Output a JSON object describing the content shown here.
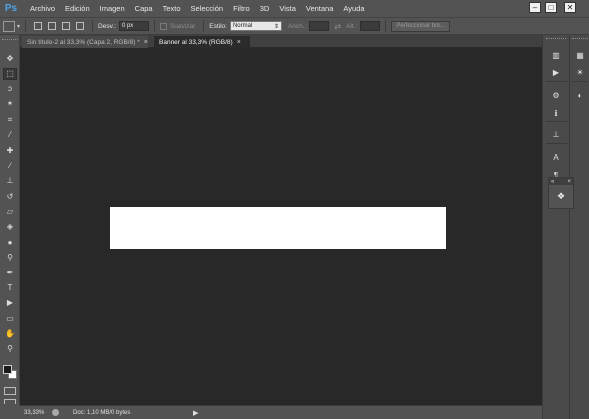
{
  "app": {
    "logo": "Ps"
  },
  "menu": [
    "Archivo",
    "Edición",
    "Imagen",
    "Capa",
    "Texto",
    "Selección",
    "Filtro",
    "3D",
    "Vista",
    "Ventana",
    "Ayuda"
  ],
  "window_controls": {
    "minimize": "–",
    "maximize": "□",
    "close": "✕"
  },
  "options_bar": {
    "feather_label": "Desv.:",
    "feather_value": "0 px",
    "antialias_label": "Suavizar",
    "style_label": "Estilo:",
    "style_value": "Normal",
    "width_label": "Anch.:",
    "height_label": "Alt.:",
    "refine_button": "Perfeccionar bor..."
  },
  "tabs": [
    {
      "label": "Sin título-2 al 33,3% (Capa 2, RGB/8) *",
      "active": false,
      "close": "×"
    },
    {
      "label": "Banner al 33,3% (RGB/8)",
      "active": true,
      "close": "×"
    }
  ],
  "tools": [
    {
      "name": "move-tool",
      "glyph": "✥"
    },
    {
      "name": "marquee-tool",
      "glyph": "⬚",
      "selected": true
    },
    {
      "name": "lasso-tool",
      "glyph": "ↄ"
    },
    {
      "name": "quick-selection-tool",
      "glyph": "✶"
    },
    {
      "name": "crop-tool",
      "glyph": "⌗"
    },
    {
      "name": "eyedropper-tool",
      "glyph": "⁄"
    },
    {
      "name": "healing-brush-tool",
      "glyph": "✚"
    },
    {
      "name": "brush-tool",
      "glyph": "∕"
    },
    {
      "name": "clone-stamp-tool",
      "glyph": "⊥"
    },
    {
      "name": "history-brush-tool",
      "glyph": "↺"
    },
    {
      "name": "eraser-tool",
      "glyph": "▱"
    },
    {
      "name": "paint-bucket-tool",
      "glyph": "◈"
    },
    {
      "name": "blur-tool",
      "glyph": "●"
    },
    {
      "name": "dodge-tool",
      "glyph": "⚲"
    },
    {
      "name": "pen-tool",
      "glyph": "✒"
    },
    {
      "name": "type-tool",
      "glyph": "T"
    },
    {
      "name": "path-selection-tool",
      "glyph": "▶"
    },
    {
      "name": "rectangle-tool",
      "glyph": "▭"
    },
    {
      "name": "hand-tool",
      "glyph": "✋"
    },
    {
      "name": "zoom-tool",
      "glyph": "⚲"
    }
  ],
  "colors": {
    "foreground": "#1a1a1a",
    "background": "#ffffff",
    "canvas_bg": "#282828",
    "ui_bg": "#535353",
    "logo_blue": "#4fa3e8"
  },
  "status": {
    "zoom": "33,33%",
    "doc_info": "Doc: 1,10 MB/0 bytes",
    "arrow": "▶"
  },
  "right_panels_col1": [
    {
      "name": "histogram-icon",
      "glyph": "▥"
    },
    {
      "name": "play-actions-icon",
      "glyph": "▶"
    },
    {
      "name": "adjustments-icon",
      "glyph": "⚙"
    },
    {
      "name": "info-icon",
      "glyph": "ℹ"
    },
    {
      "name": "align-icon",
      "glyph": "⊥"
    },
    {
      "name": "character-icon",
      "glyph": "A"
    },
    {
      "name": "paragraph-icon",
      "glyph": "¶"
    }
  ],
  "right_panels_col2": [
    {
      "name": "swatches-grid-icon",
      "glyph": "▦"
    },
    {
      "name": "brightness-icon",
      "glyph": "☀"
    },
    {
      "name": "styles-icon",
      "glyph": "◐"
    }
  ],
  "layers_float": {
    "close": "×",
    "collapse": "«",
    "glyph": "❖"
  }
}
